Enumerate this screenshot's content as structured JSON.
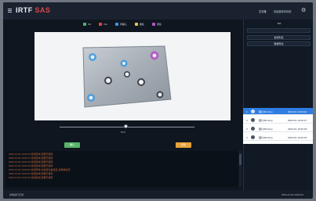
{
  "app": {
    "logo_part1": "IRTF",
    "logo_part2": "SAS",
    "user_name": "王青雄",
    "user_role": "欢迎使用本系统"
  },
  "legend": [
    {
      "label": "OK",
      "color": "#57b468"
    },
    {
      "label": "NG",
      "color": "#e04747"
    },
    {
      "label": "待确认",
      "color": "#3b9ae1"
    },
    {
      "label": "漏检",
      "color": "#f0c24a"
    },
    {
      "label": "误检",
      "color": "#b554c7"
    }
  ],
  "slider": {
    "value_text": "50%",
    "value_fraction": 0.5
  },
  "buttons": {
    "ok_label": "确认",
    "review_label": "复检"
  },
  "log_lines": [
    "2021-01-01 10:02:16 检测完成 结果已保存",
    "2021-01-01 10:02:17 检测完成 结果已保存",
    "2021-01-01 10:02:18 检测完成 结果已保存",
    "2021-01-01 10:02:19 检测完成 结果已保存",
    "2021-01-01 10:02:20 检测异常 请检查设备连接 请重新检测",
    "2021-01-01 10:02:21 检测完成 结果已保存",
    "2021-01-01 10:02:22 检测完成 结果已保存"
  ],
  "right_panel": {
    "count": "6%",
    "row_empty": "",
    "section_title": "检测列表",
    "section_sub": "数据导出"
  },
  "queue": [
    {
      "index": "1",
      "text": "图片001.bmp",
      "time": "2021/1/1 10:02:16",
      "selected": true
    },
    {
      "index": "2",
      "text": "图片002.bmp",
      "time": "2021/1/1 10:02:17",
      "selected": false
    },
    {
      "index": "3",
      "text": "图片003.bmp",
      "time": "2021/1/1 10:02:18",
      "selected": false
    },
    {
      "index": "4",
      "text": "图片004.bmp",
      "time": "2021/1/1 10:02:19",
      "selected": false
    }
  ],
  "status": {
    "left": "系统运行正常",
    "right": "2021-01-01 10:02:22"
  }
}
